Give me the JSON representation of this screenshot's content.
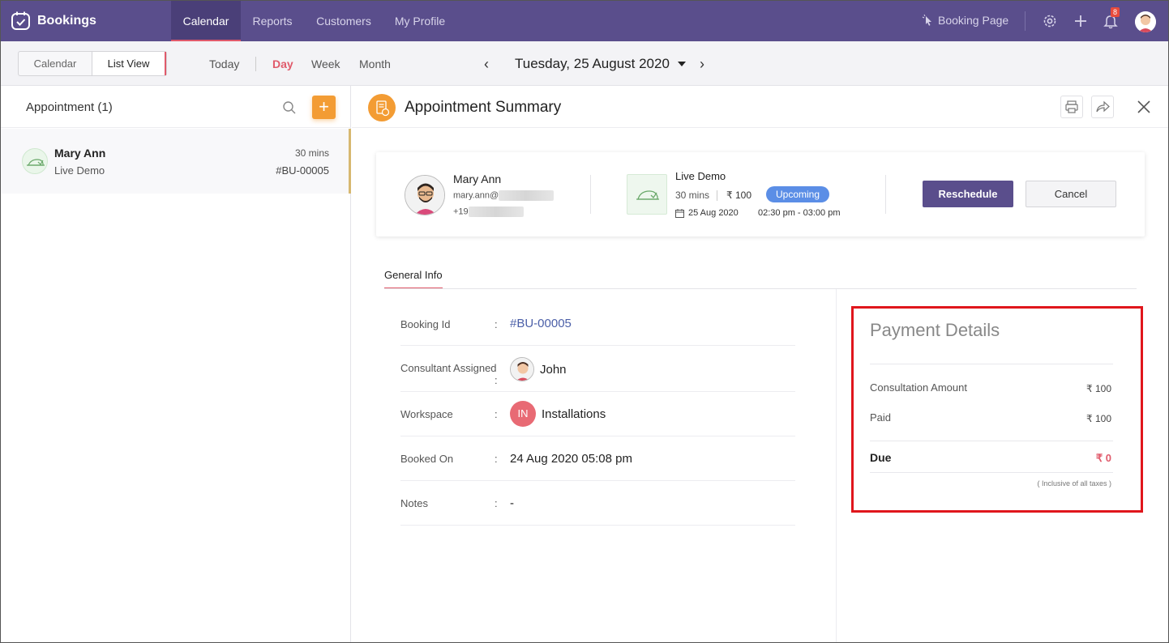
{
  "app": {
    "title": "Bookings",
    "nav_tabs": [
      {
        "label": "Calendar",
        "active": true
      },
      {
        "label": "Reports",
        "active": false
      },
      {
        "label": "Customers",
        "active": false
      },
      {
        "label": "My Profile",
        "active": false
      }
    ],
    "booking_page_label": "Booking Page",
    "notification_count": "8",
    "accent": "#5a4e8c",
    "highlight": "#e05a6b"
  },
  "toolbar": {
    "view_calendar": "Calendar",
    "view_list": "List View",
    "today": "Today",
    "ranges": [
      "Day",
      "Week",
      "Month"
    ],
    "active_range": "Day",
    "prev": "‹",
    "next": "›",
    "date_title": "Tuesday, 25 August 2020"
  },
  "appointments": {
    "title": "Appointment (1)",
    "add": "+",
    "items": [
      {
        "name": "Mary Ann",
        "service": "Live Demo",
        "duration": "30 mins",
        "id": "#BU-00005"
      }
    ]
  },
  "summary": {
    "title": "Appointment Summary",
    "customer": {
      "name": "Mary Ann",
      "email_prefix": "mary.ann@",
      "phone_prefix": "+19"
    },
    "service": {
      "name": "Live Demo",
      "duration": "30 mins",
      "price": "₹ 100",
      "status": "Upcoming",
      "status_color": "#5b8ee6",
      "date": "25 Aug 2020",
      "time": "02:30 pm - 03:00 pm"
    },
    "reschedule_label": "Reschedule",
    "cancel_label": "Cancel"
  },
  "general_info": {
    "tab_label": "General Info",
    "rows": [
      {
        "label": "Booking Id",
        "value": "#BU-00005"
      },
      {
        "label": "Consultant Assigned",
        "value": "John"
      },
      {
        "label": "Workspace",
        "value": "Installations",
        "badge": "IN"
      },
      {
        "label": "Booked On",
        "value": "24 Aug 2020 05:08 pm"
      },
      {
        "label": "Notes",
        "value": "-"
      }
    ],
    "colon": ":"
  },
  "payment": {
    "title": "Payment Details",
    "consultation_label": "Consultation Amount",
    "consultation_amount": "₹ 100",
    "paid_label": "Paid",
    "paid_amount": "₹ 100",
    "due_label": "Due",
    "due_amount": "₹ 0",
    "note": "( Inclusive of all taxes )",
    "box_color": "#e0161c"
  }
}
